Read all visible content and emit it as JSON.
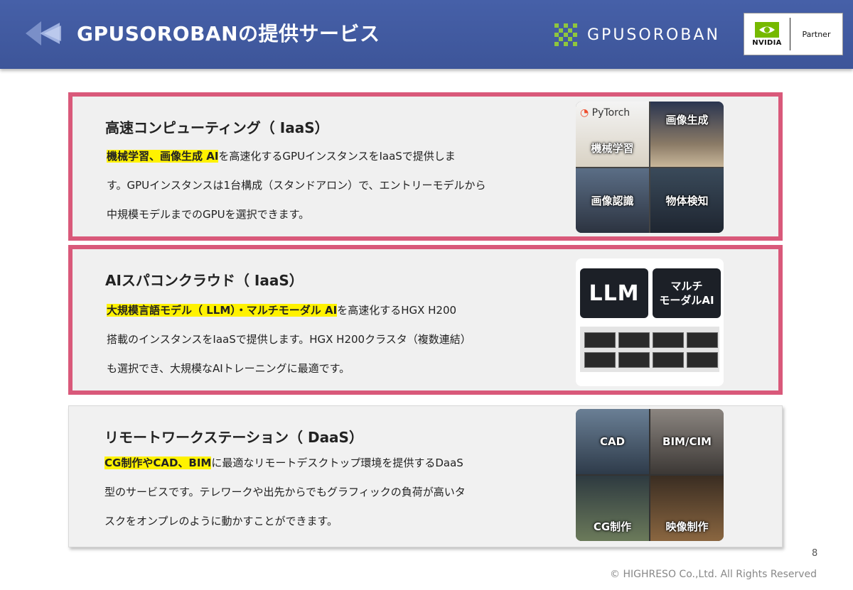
{
  "header": {
    "title": "GPUSOROBANの提供サービス",
    "brand": "GPUSOROBAN",
    "partner_logo": "NVIDIA",
    "partner_label": "Partner"
  },
  "services": [
    {
      "title": "高速コンピューティング（ IaaS）",
      "highlight": "機械学習、画像生成 AI",
      "lines": [
        "を高速化するGPUインスタンスをIaaSで提供しま",
        "す。GPUインスタンスは1台構成（スタンドアロン）で、エントリーモデルから",
        "中規模モデルまでのGPUを選択できます。"
      ],
      "tiles": [
        "機械学習",
        "画像生成",
        "画像認識",
        "物体検知"
      ],
      "tile_brand": "PyTorch"
    },
    {
      "title": "AIスパコンクラウド（ IaaS）",
      "highlight": "大規模言語モデル（ LLM）・マルチモーダル AI",
      "lines": [
        "を高速化するHGX H200",
        "搭載のインスタンスをIaaSで提供します。HGX H200クラスタ（複数連結）",
        "も選択でき、大規模なAIトレーニングに最適です。"
      ],
      "tiles": [
        "LLM",
        "マルチ\nモーダルAI"
      ]
    },
    {
      "title": "リモートワークステーション（ DaaS）",
      "highlight": "CG制作やCAD、BIM",
      "lines": [
        "に最適なリモートデスクトップ環境を提供するDaaS",
        "型のサービスです。テレワークや出先からでもグラフィックの負荷が高いタ",
        "スクをオンプレのように動かすことができます。"
      ],
      "tiles": [
        "CAD",
        "BIM/CIM",
        "CG制作",
        "映像制作"
      ]
    }
  ],
  "footer": {
    "page": "8",
    "copyright": "© HIGHRESO Co.,Ltd. All Rights Reserved"
  },
  "colors": {
    "header": "#4660a8",
    "highlight_border": "#d9597a",
    "marker": "#fff200",
    "brand_green": "#76b900"
  }
}
